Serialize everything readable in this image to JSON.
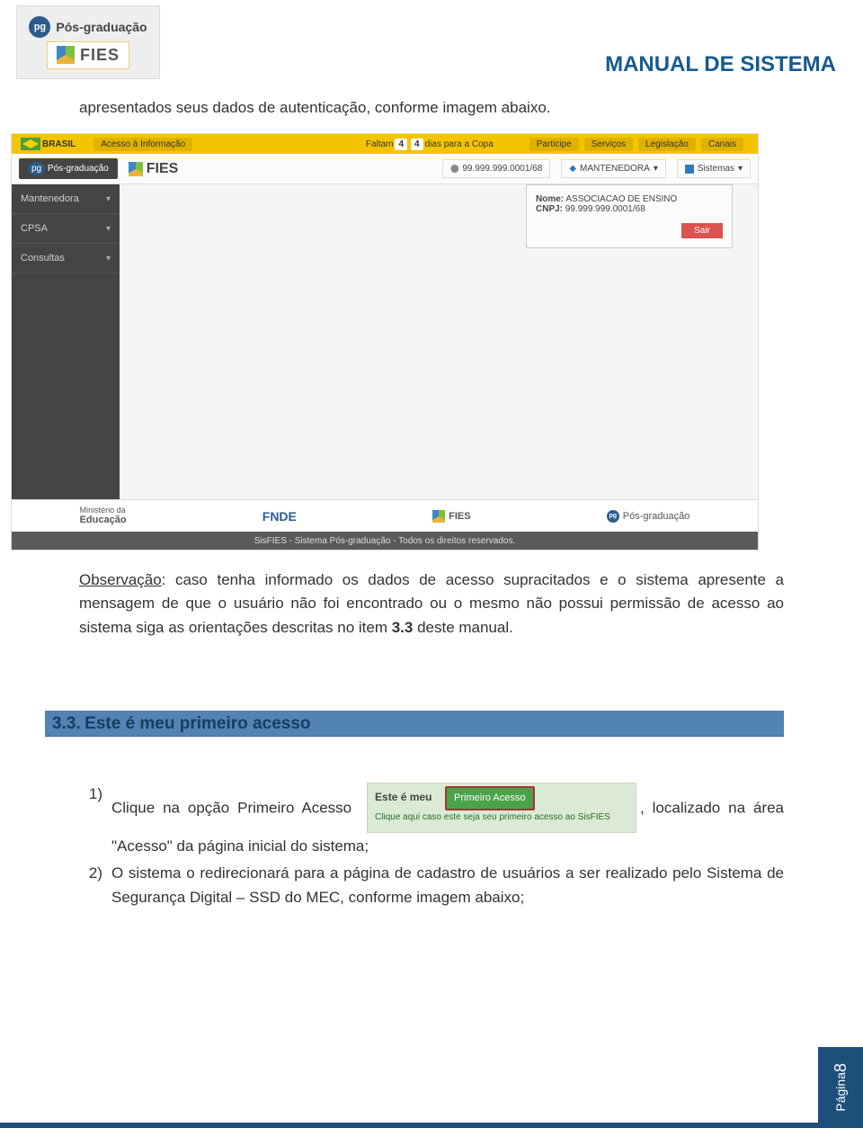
{
  "header": {
    "pg_badge": "pg",
    "pg_label": "Pós-graduação",
    "fies_label": "FIES",
    "doc_title": "MANUAL DE SISTEMA"
  },
  "intro_text": "apresentados seus dados de autenticação, conforme imagem abaixo.",
  "screenshot": {
    "topbar": {
      "brasil": "BRASIL",
      "acesso_info": "Acesso à Informação",
      "faltam": "Faltam",
      "d1": "4",
      "d2": "4",
      "dias": "dias para a Copa",
      "participe": "Participe",
      "servicos": "Serviços",
      "legislacao": "Legislação",
      "canais": "Canais"
    },
    "ribbon": {
      "pg": "Pós-graduação",
      "fies": "FIES",
      "user_id": "99.999.999.0001/68",
      "mantenedora_btn": "MANTENEDORA",
      "sistemas_btn": "Sistemas"
    },
    "sidebar": {
      "items": [
        "Mantenedora",
        "CPSA",
        "Consultas"
      ]
    },
    "popover": {
      "nome_lbl": "Nome:",
      "nome_val": "ASSOCIACAO DE ENSINO",
      "cnpj_lbl": "CNPJ:",
      "cnpj_val": "99.999.999.0001/68",
      "sair": "Sair"
    },
    "footer": {
      "ministerio_sub": "Ministério da",
      "ministerio": "Educação",
      "fnde": "FNDE",
      "fies": "FIES",
      "pg": "Pós-graduação",
      "rights": "SisFIES - Sistema Pós-graduação - Todos os direitos reservados."
    }
  },
  "observacao": {
    "label": "Observação",
    "text_rest": ": caso tenha informado os dados de acesso supracitados e o sistema apresente a mensagem de que o usuário não foi encontrado ou o mesmo não possui permissão de acesso ao sistema siga as orientações descritas no item ",
    "item_ref": "3.3",
    "text_tail": " deste manual."
  },
  "section": {
    "num": "3.3.",
    "title": "Este é meu primeiro acesso"
  },
  "primeiro_inline": {
    "prefix": "Este é meu",
    "button": "Primeiro Acesso",
    "hint": "Clique aqui caso este seja seu primeiro acesso ao SisFIES"
  },
  "steps": {
    "s1_num": "1)",
    "s1_a": "Clique na opção  Primeiro Acesso",
    "s1_b": ", localizado na área \"Acesso\" da página inicial do sistema;",
    "s2_num": "2)",
    "s2": "O sistema o redirecionará para a página de cadastro de usuários a ser realizado pelo Sistema de Segurança Digital – SSD do MEC, conforme imagem abaixo;"
  },
  "footer": {
    "page_label": "Página",
    "page_num": "8"
  }
}
